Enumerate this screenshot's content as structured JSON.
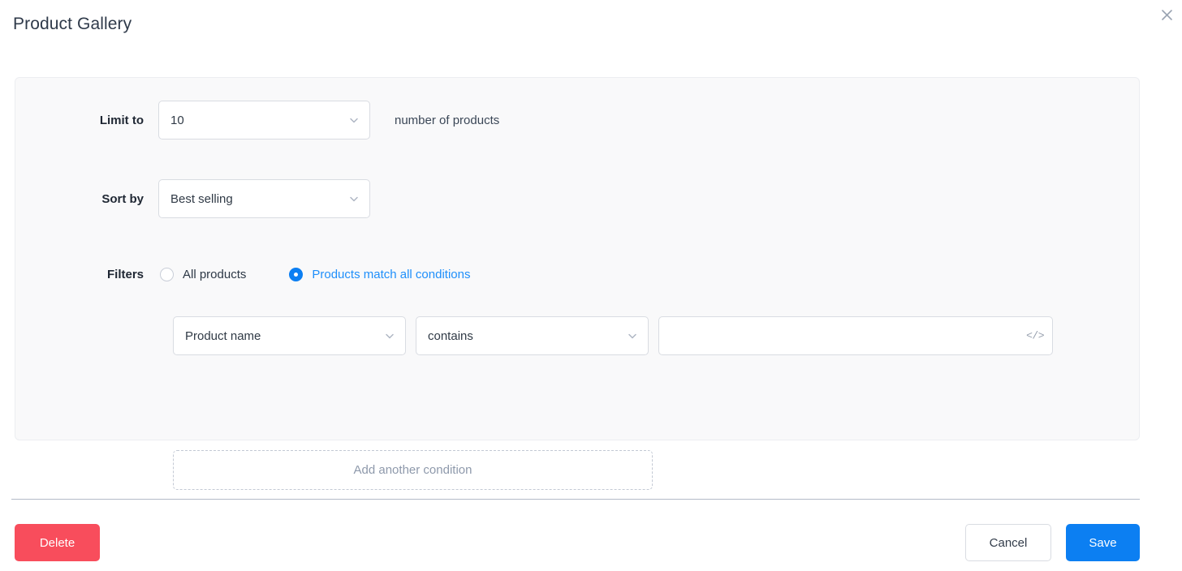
{
  "header": {
    "title": "Product Gallery",
    "close_icon": "close-icon"
  },
  "form": {
    "limit": {
      "label": "Limit to",
      "value": "10",
      "suffix": "number of products",
      "chevron_icon": "chevron-down-icon"
    },
    "sort": {
      "label": "Sort by",
      "value": "Best selling",
      "chevron_icon": "chevron-down-icon"
    },
    "filters": {
      "label": "Filters",
      "options": [
        {
          "label": "All products",
          "selected": false
        },
        {
          "label": "Products match all conditions",
          "selected": true
        }
      ],
      "condition": {
        "field": "Product name",
        "operator": "contains",
        "value": "",
        "value_placeholder": "",
        "code_icon": "</>",
        "chevron_icon": "chevron-down-icon"
      },
      "add_condition_label": "Add another condition"
    }
  },
  "footer": {
    "delete_label": "Delete",
    "cancel_label": "Cancel",
    "save_label": "Save"
  },
  "colors": {
    "accent": "#0c7ff2",
    "danger": "#f84d5c",
    "panel_bg": "#f9f9fa",
    "border": "#d9dce2",
    "text": "#303a46",
    "muted": "#8e99ab"
  }
}
